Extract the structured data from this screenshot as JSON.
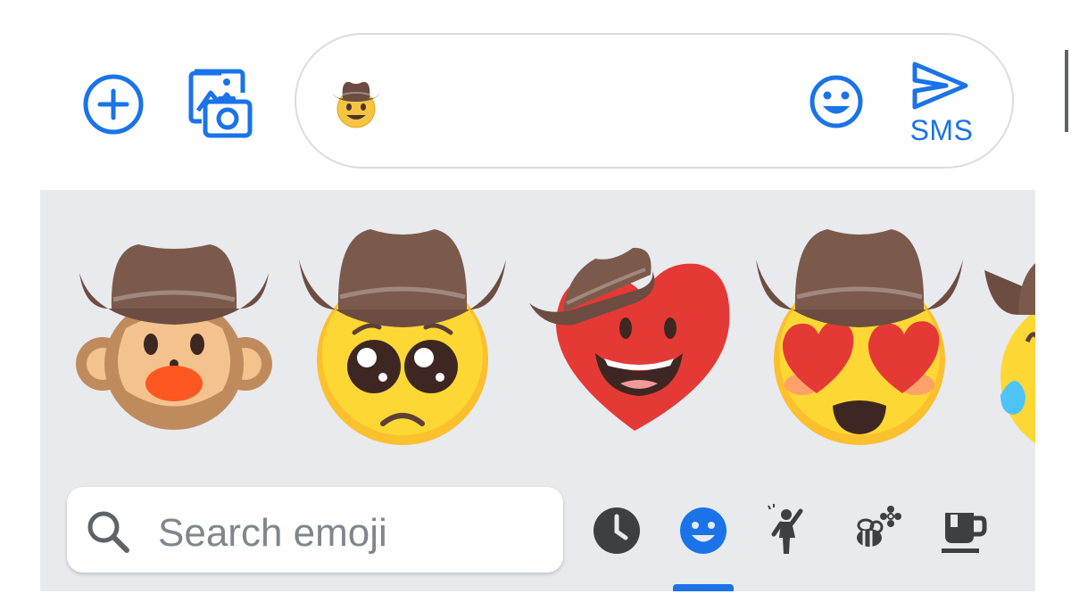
{
  "compose": {
    "send_label": "SMS",
    "draft_content": "cowboy-emoji"
  },
  "icons": {
    "add": "add-circle-icon",
    "media": "image-camera-icon",
    "emoji": "smiley-icon",
    "send": "send-arrow-icon"
  },
  "emoji_panel": {
    "suggestions": [
      "cowboy-monkey",
      "cowboy-pleading-face",
      "cowboy-heart-face",
      "cowboy-heart-eyes",
      "cowboy-crying-face"
    ],
    "search": {
      "placeholder": "Search emoji"
    },
    "categories": [
      "recent",
      "smileys",
      "people",
      "animals-nature",
      "food-drink"
    ],
    "active_category": "smileys"
  },
  "colors": {
    "accent": "#1a73e8",
    "panel_bg": "#e8eaed",
    "hat": "#6d4c41",
    "face": "#fbc02d",
    "heart": "#e53935"
  }
}
